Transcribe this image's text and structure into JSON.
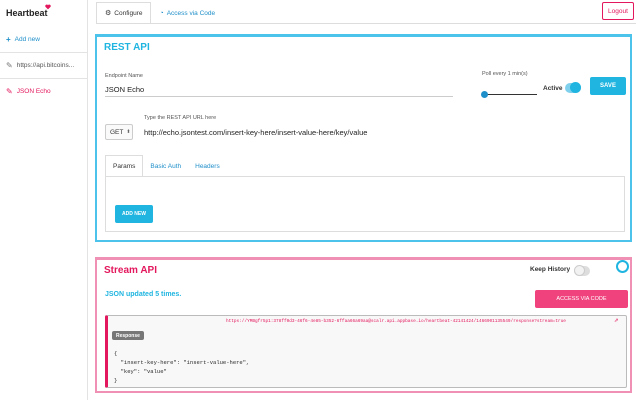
{
  "sidebar": {
    "brand": "Heartbeat",
    "add_new": "Add new",
    "items": [
      {
        "label": "https://api.bitcoins..."
      },
      {
        "label": "JSON Echo"
      }
    ]
  },
  "tabs": [
    {
      "label": "Configure"
    },
    {
      "label": "Access via Code"
    }
  ],
  "logout": "Logout",
  "rest": {
    "title": "REST API",
    "endpoint_label": "Endpoint Name",
    "endpoint_value": "JSON Echo",
    "poll_label": "Poll every 1 min(s)",
    "poll_fraction": 0.0,
    "active_label": "Active",
    "active": true,
    "save_label": "SAVE",
    "url_label": "Type the REST API URL here",
    "method": "GET",
    "url_value": "http://echo.jsontest.com/insert-key-here/insert-value-here/key/value",
    "inner_tabs": [
      "Params",
      "Basic Auth",
      "Headers"
    ],
    "add_new_label": "ADD NEW"
  },
  "stream": {
    "title": "Stream API",
    "keep_history_label": "Keep History",
    "keep_history": false,
    "updated_prefix": "JSON updated ",
    "updated_count": "5",
    "updated_suffix": " times.",
    "access_button": "ACCESS VIA CODE",
    "response_badge": "Response",
    "response_url": "https://YMBgfr5p1:378ff0d3-46f6-4e85-b352-6ffaa66a69aa@scalr.api.appbase.io/heartbeat-42141424/1466901135549/response?stream=true",
    "json_lines": [
      "{",
      "  \"insert-key-here\": \"insert-value-here\",",
      "  \"key\": \"value\"",
      "}"
    ]
  },
  "colors": {
    "rest_accent": "#1fb5e0",
    "stream_accent": "#e3175d",
    "link": "#1f8fc9"
  },
  "icons": {
    "brand": "heart-icon",
    "add": "plus-icon",
    "pin": "pin-icon",
    "configure": "gear-icon",
    "access_code": "globe-icon",
    "external": "external-link-icon"
  }
}
